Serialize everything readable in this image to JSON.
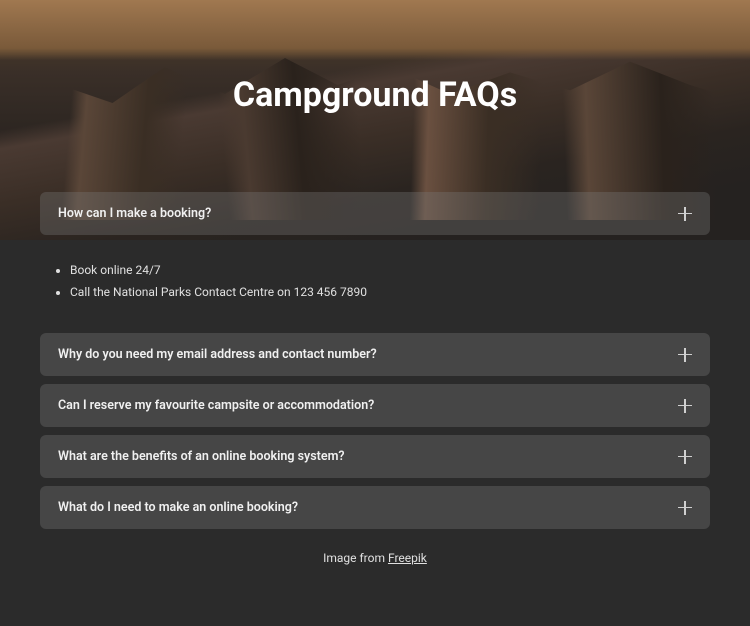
{
  "page": {
    "title": "Campground FAQs"
  },
  "faqs": [
    {
      "question": "How can I make a booking?",
      "expanded": true,
      "answers": [
        "Book online 24/7",
        "Call the National Parks Contact Centre on 123 456 7890"
      ]
    },
    {
      "question": "Why do you need my email address and contact number?",
      "expanded": false
    },
    {
      "question": "Can I reserve my favourite campsite or accommodation?",
      "expanded": false
    },
    {
      "question": "What are the benefits of an online booking system?",
      "expanded": false
    },
    {
      "question": "What do I need to make an online booking?",
      "expanded": false
    }
  ],
  "credit": {
    "prefix": "Image from ",
    "link_text": "Freepik"
  }
}
